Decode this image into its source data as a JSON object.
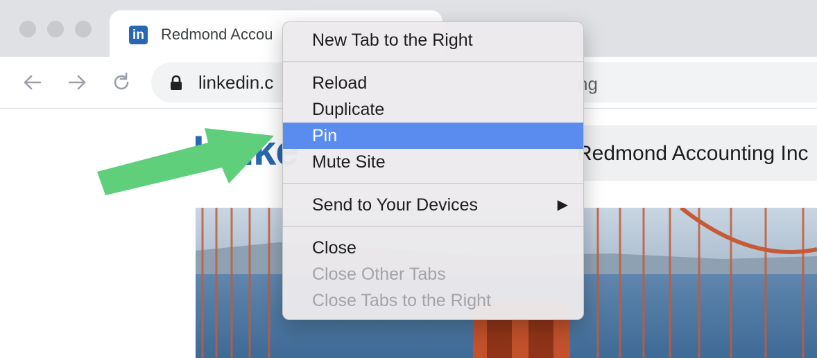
{
  "tab": {
    "favicon_text": "in",
    "title": "Redmond Accou"
  },
  "toolbar": {
    "url": "linkedin.c",
    "url_tail": "ng"
  },
  "page": {
    "brand_word": "Linke",
    "company_name": "Redmond Accounting Inc"
  },
  "context_menu": {
    "items": [
      {
        "label": "New Tab to the Right",
        "enabled": true
      },
      {
        "label": "Reload",
        "enabled": true
      },
      {
        "label": "Duplicate",
        "enabled": true
      },
      {
        "label": "Pin",
        "enabled": true,
        "highlighted": true
      },
      {
        "label": "Mute Site",
        "enabled": true
      },
      {
        "label": "Send to Your Devices",
        "enabled": true,
        "submenu": true
      },
      {
        "label": "Close",
        "enabled": true
      },
      {
        "label": "Close Other Tabs",
        "enabled": false
      },
      {
        "label": "Close Tabs to the Right",
        "enabled": false
      }
    ],
    "submenu_glyph": "▶"
  },
  "icons": {
    "back": "back-arrow-icon",
    "forward": "forward-arrow-icon",
    "reload": "reload-icon",
    "lock": "lock-icon",
    "annotation": "green-pointer-arrow-icon"
  },
  "colors": {
    "highlight": "#5a8cf0",
    "brand": "#2867b2",
    "annotation_arrow": "#5fcf7c"
  }
}
